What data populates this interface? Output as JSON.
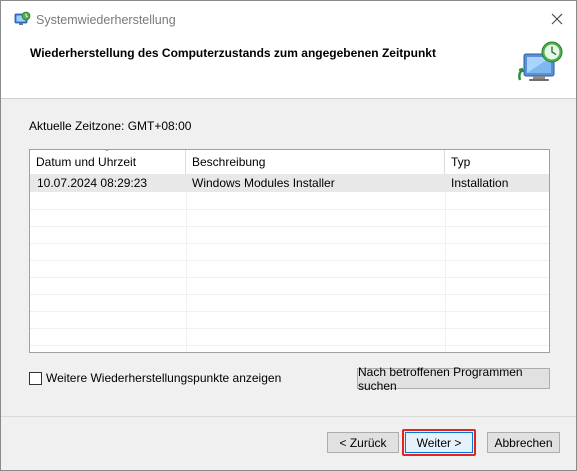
{
  "window": {
    "title": "Systemwiederherstellung",
    "icons": {
      "app": "system-restore-icon",
      "close": "close-icon",
      "header": "monitor-restore-clock-icon"
    }
  },
  "header": {
    "heading": "Wiederherstellung des Computerzustands zum angegebenen Zeitpunkt"
  },
  "content": {
    "timezone": "Aktuelle Zeitzone: GMT+08:00",
    "table": {
      "columns": [
        "Datum und Uhrzeit",
        "Beschreibung",
        "Typ"
      ],
      "rows": [
        {
          "date": "10.07.2024 08:29:23",
          "description": "Windows Modules Installer",
          "type": "Installation"
        }
      ]
    },
    "checkbox": {
      "label": "Weitere Wiederherstellungspunkte anzeigen",
      "checked": false
    },
    "affected_button": "Nach betroffenen Programmen suchen"
  },
  "footer": {
    "back": "< Zurück",
    "next": "Weiter >",
    "cancel": "Abbrechen",
    "highlight_color": "#e8221e"
  },
  "colors": {
    "content_bg": "#f0f0f0",
    "selected_row": "#e8e8e8",
    "focus_border": "#0078d7"
  }
}
